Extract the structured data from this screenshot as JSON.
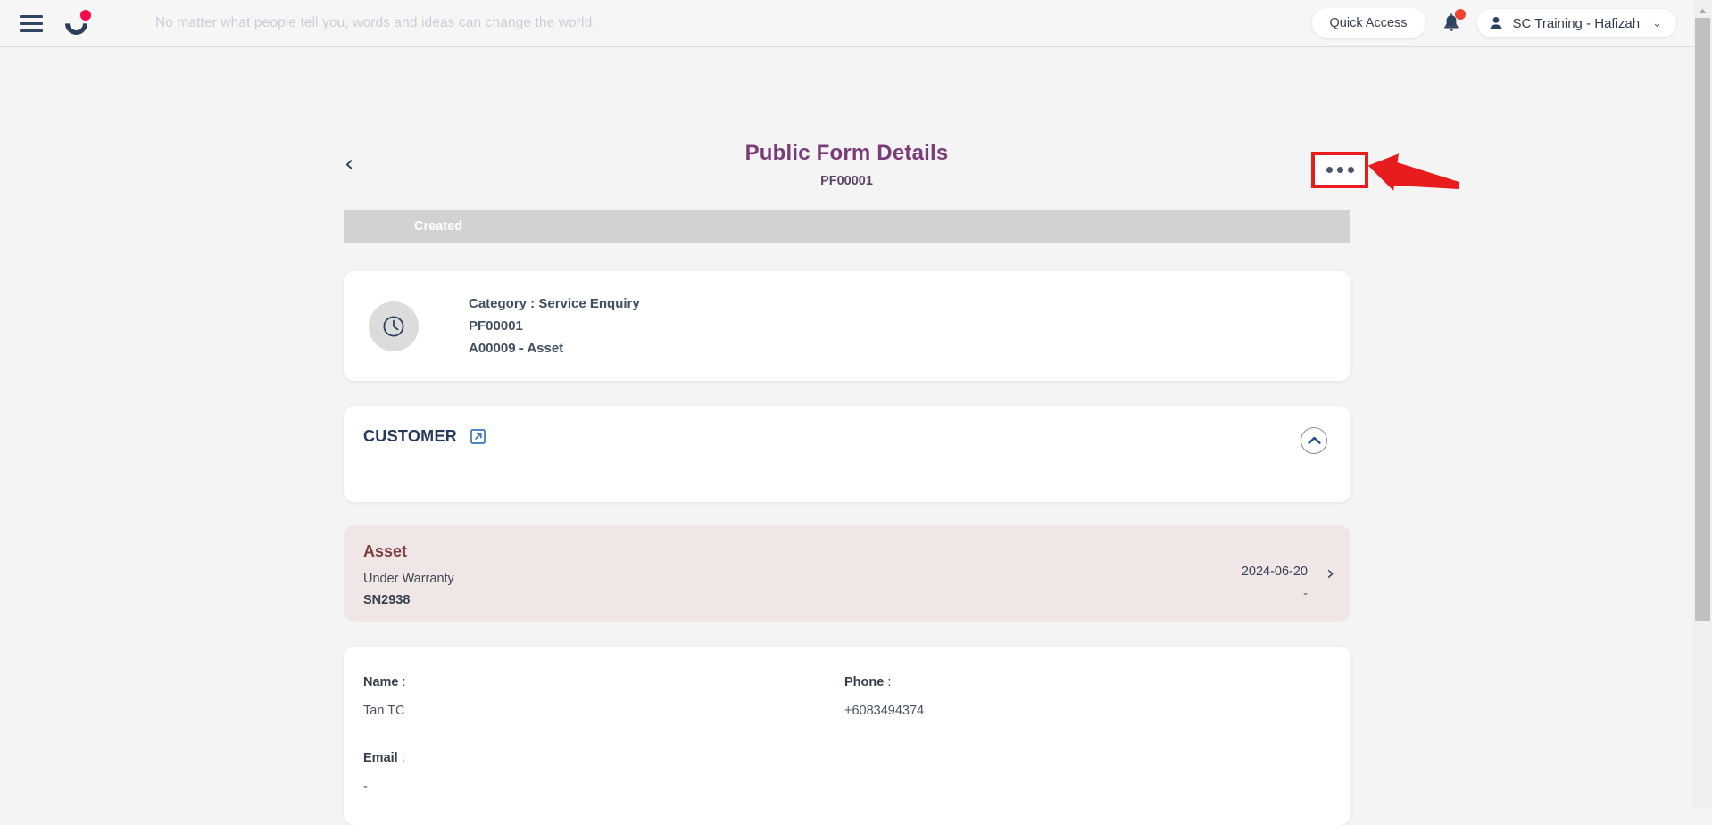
{
  "topbar": {
    "menu_icon": "hamburger-icon",
    "logo_icon": "brand-logo-icon",
    "tagline": "No matter what people tell you, words and ideas can change the world.",
    "quick_access_label": "Quick Access",
    "notification_icon": "bell-icon",
    "user_icon": "person-icon",
    "user_name": "SC Training - Hafizah",
    "chevron": "⌄"
  },
  "page_header": {
    "back_icon": "‹",
    "title": "Public Form Details",
    "subtitle": "PF00001",
    "more_menu_label": "•••"
  },
  "status": {
    "label": "Created"
  },
  "category_card": {
    "icon": "clock-icon",
    "line1": "Category : Service Enquiry",
    "line2": "PF00001",
    "line3": "A00009 - Asset"
  },
  "customer_section": {
    "title": "CUSTOMER",
    "external_link_icon": "external-link-icon",
    "collapse_icon": "chevron-up-icon"
  },
  "asset_card": {
    "title": "Asset",
    "warranty": "Under Warranty",
    "serial": "SN2938",
    "date": "2024-06-20",
    "secondary": "-",
    "chevron": "›"
  },
  "details": {
    "fields": [
      {
        "label": "Name",
        "colon": " :",
        "value": "Tan TC"
      },
      {
        "label": "Phone",
        "colon": " :",
        "value": "+6083494374"
      },
      {
        "label": "Email",
        "colon": " :",
        "value": "-"
      }
    ]
  },
  "annotation": {
    "highlight_color": "#e81c1c",
    "arrow_color": "#e81c1c"
  },
  "colors": {
    "brand_navy": "#2b3f5c",
    "brand_pink": "#fa0a4b",
    "title_purple": "#7a3b79",
    "asset_bg": "#f0e6e5",
    "status_gray": "#d2d2d2",
    "page_bg": "#f4f4f4"
  },
  "scrollbar": {
    "up_arrow": "▲"
  }
}
